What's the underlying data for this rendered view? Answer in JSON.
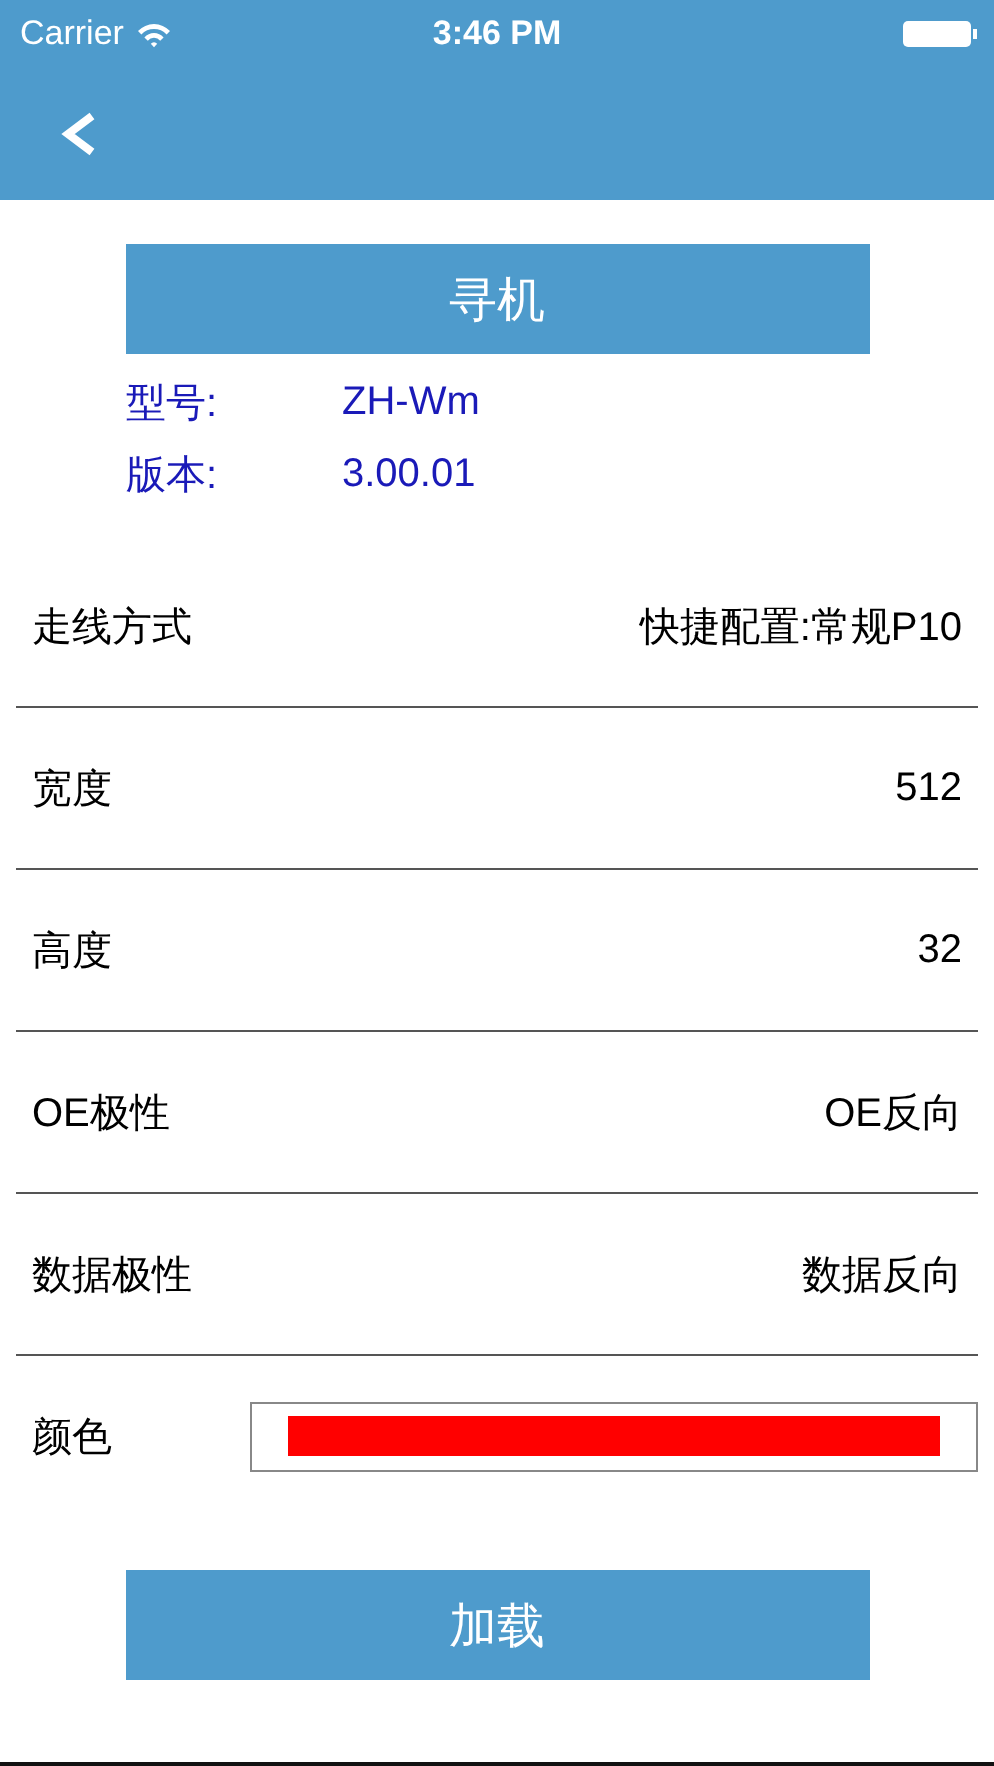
{
  "status_bar": {
    "carrier": "Carrier",
    "time": "3:46 PM"
  },
  "search_button": "寻机",
  "device_info": [
    {
      "label": "型号:",
      "value": "ZH-Wm"
    },
    {
      "label": "版本:",
      "value": "3.00.01"
    }
  ],
  "settings": [
    {
      "kind": "value",
      "label": "走线方式",
      "value": "快捷配置:常规P10"
    },
    {
      "kind": "value",
      "label": "宽度",
      "value": "512"
    },
    {
      "kind": "value",
      "label": "高度",
      "value": "32"
    },
    {
      "kind": "value",
      "label": "OE极性",
      "value": "OE反向"
    },
    {
      "kind": "value",
      "label": "数据极性",
      "value": "数据反向"
    },
    {
      "kind": "color",
      "label": "颜色",
      "color": "#ff0000"
    }
  ],
  "load_button": "加载"
}
